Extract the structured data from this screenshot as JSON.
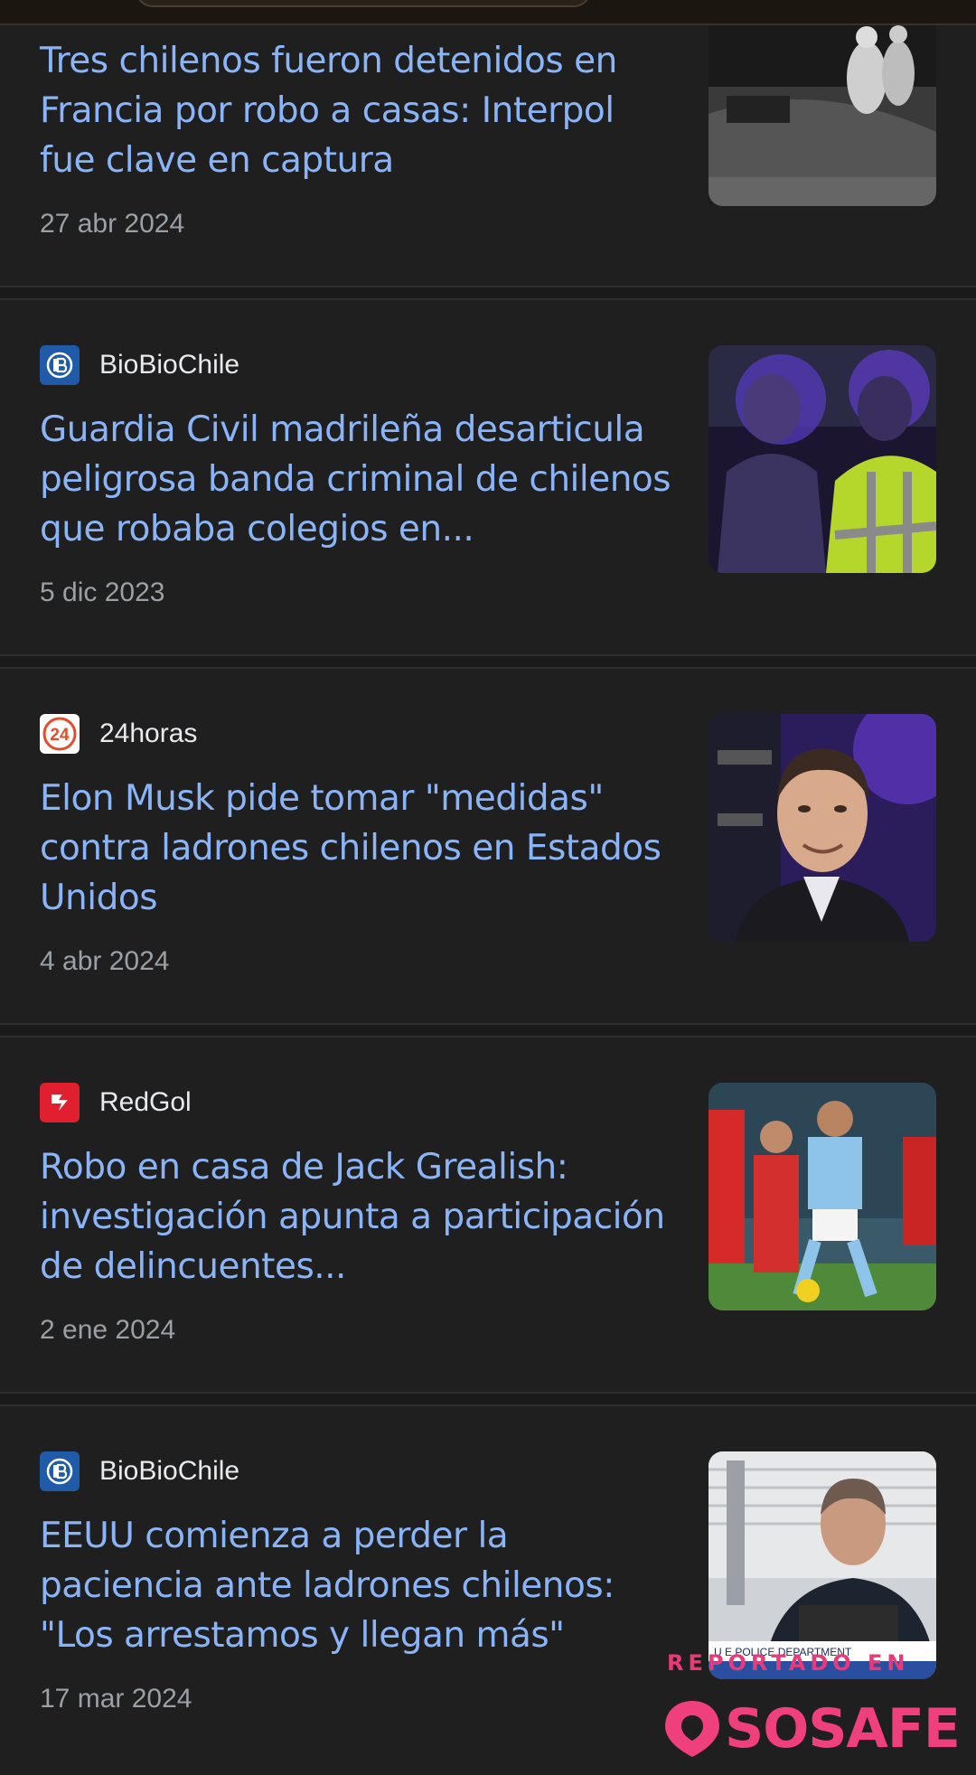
{
  "articles": [
    {
      "source": "",
      "headline": "Tres chilenos fueron detenidos en Francia por robo a casas: Interpol fue clave en captura",
      "date": "27 abr 2024",
      "thumb_icon": "night-surveillance-photo"
    },
    {
      "source": "BioBioChile",
      "favicon": "biobiochile-icon",
      "headline": "Guardia Civil madrileña desarticula peligrosa banda criminal de chilenos que robaba colegios en...",
      "date": "5 dic 2023",
      "thumb_icon": "guardia-civil-photo"
    },
    {
      "source": "24horas",
      "favicon": "24horas-icon",
      "headline": "Elon Musk pide tomar \"medidas\" contra ladrones chilenos en Estados Unidos",
      "date": "4 abr 2024",
      "thumb_icon": "elon-musk-photo"
    },
    {
      "source": "RedGol",
      "favicon": "redgol-icon",
      "headline": "Robo en casa de Jack Grealish: investigación apunta a participación de delincuentes...",
      "date": "2 ene 2024",
      "thumb_icon": "football-match-photo"
    },
    {
      "source": "BioBioChile",
      "favicon": "biobiochile-icon",
      "headline": "EEUU comienza a perder la paciencia ante ladrones chilenos: \"Los arrestamos y llegan más\"",
      "date": "17 mar 2024",
      "thumb_icon": "police-press-conference-photo",
      "thumb_caption": "U E POLICE DEPARTMENT"
    }
  ],
  "watermark": {
    "top": "REPORTADO EN",
    "brand": "SOSAFE"
  },
  "colors": {
    "background": "#1f1f1f",
    "headline": "#8ab4f8",
    "source": "#e8eaed",
    "date": "#9aa0a6",
    "watermark": "#ef3f7c"
  }
}
